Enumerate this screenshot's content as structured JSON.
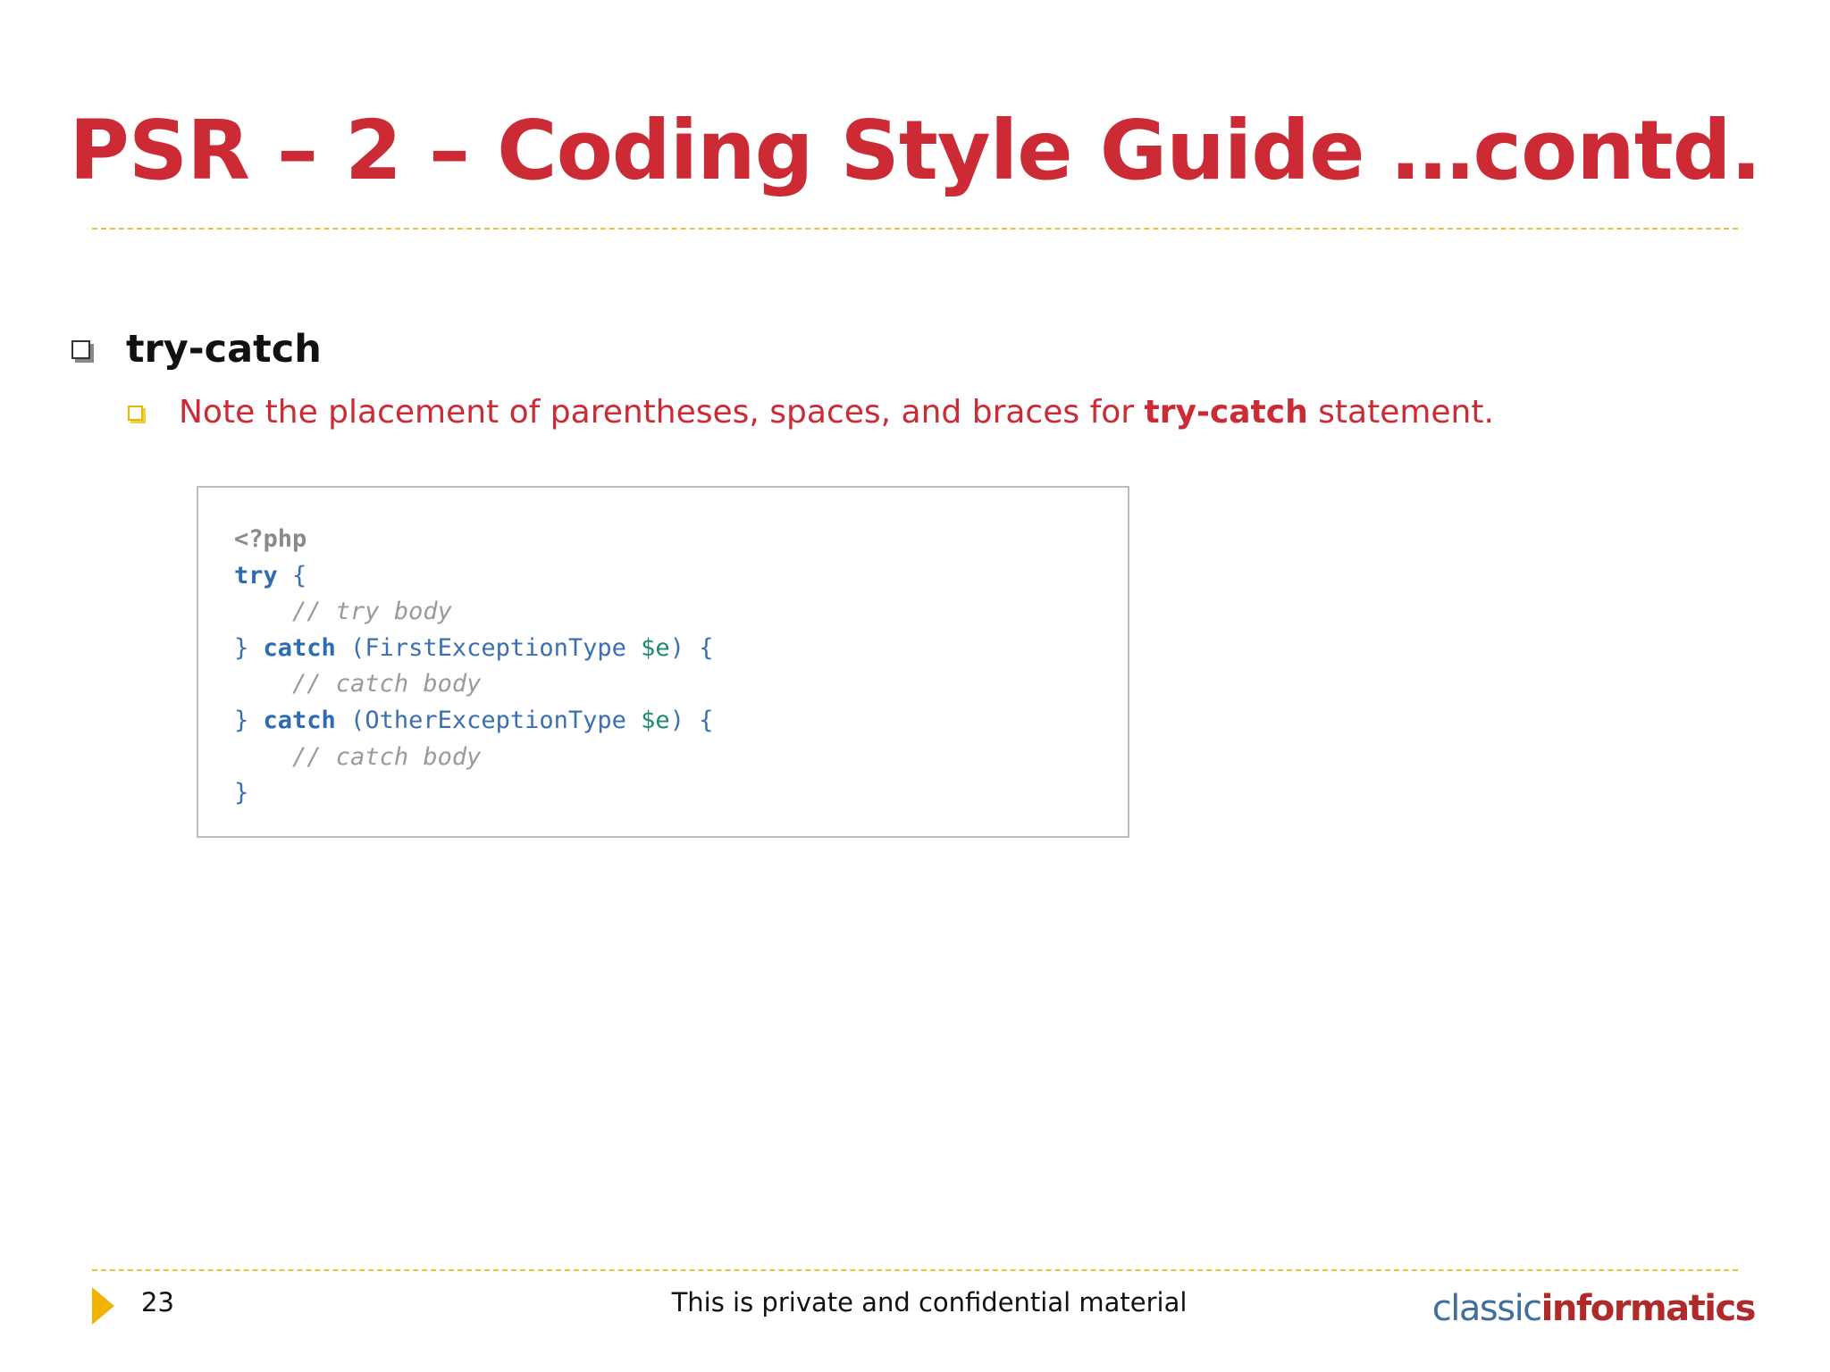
{
  "slide": {
    "title": "PSR – 2 – Coding Style Guide …contd.",
    "bullet": "try-catch",
    "sub_bullet": {
      "prefix": "Note the placement of parentheses, spaces, and braces for ",
      "bold": "try-catch",
      "suffix": " statement."
    },
    "code": {
      "open_tag": "<?php",
      "try_kw": "try",
      "open_brace": " {",
      "indent": "    ",
      "comment_try": "// try body",
      "close_brace": "} ",
      "catch_kw": "catch",
      "open_paren": " (",
      "type1": "FirstExceptionType ",
      "var": "$e",
      "close_paren_brace": ") {",
      "comment_catch": "// catch body",
      "type2": "OtherExceptionType ",
      "final_brace": "}"
    }
  },
  "footer": {
    "page_number": "23",
    "notice": "This is private and confidential material",
    "logo_part1": "classic",
    "logo_part2": "informatics"
  },
  "colors": {
    "title": "#cc2a35",
    "accent_yellow": "#e8c33a",
    "code_keyword": "#2e6bb3",
    "code_variable": "#1f8a70",
    "code_comment": "#9a9a9a"
  }
}
